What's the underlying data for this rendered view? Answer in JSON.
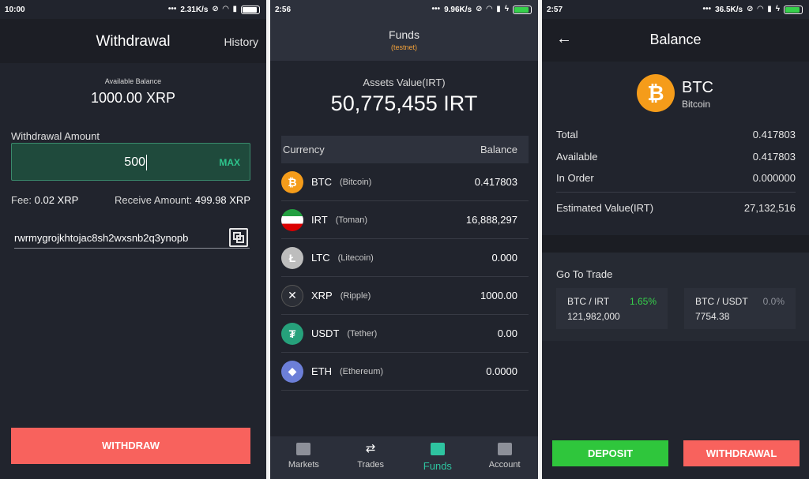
{
  "screen1": {
    "status": {
      "time": "10:00",
      "speed": "2.31K/s"
    },
    "header": {
      "title": "Withdrawal",
      "history": "History"
    },
    "available_caption": "Available Balance",
    "available_value": "1000.00 XRP",
    "amount_label": "Withdrawal Amount",
    "amount_value": "500",
    "max_label": "MAX",
    "fee_label": "Fee:",
    "fee_value": "0.02 XRP",
    "receive_label": "Receive Amount:",
    "receive_value": "499.98 XRP",
    "address": "rwrmygrojkhtojac8sh2wxsnb2q3ynopb",
    "withdraw_button": "WITHDRAW"
  },
  "screen2": {
    "status": {
      "time": "2:56",
      "speed": "9.96K/s"
    },
    "header": {
      "title": "Funds",
      "subtitle": "(testnet)"
    },
    "assets_caption": "Assets Value(IRT)",
    "assets_value": "50,775,455 IRT",
    "table_headers": {
      "currency": "Currency",
      "balance": "Balance"
    },
    "rows": [
      {
        "symbol": "BTC",
        "name": "(Bitcoin)",
        "balance": "0.417803",
        "icon": "bitcoin-icon",
        "color": "#f59c1a",
        "glyph": "₿"
      },
      {
        "symbol": "IRT",
        "name": "(Toman)",
        "balance": "16,888,297",
        "icon": "iran-flag-icon",
        "color": "#ffffff",
        "glyph": ""
      },
      {
        "symbol": "LTC",
        "name": "(Litecoin)",
        "balance": "0.000",
        "icon": "litecoin-icon",
        "color": "#bdbdbd",
        "glyph": "Ł"
      },
      {
        "symbol": "XRP",
        "name": "(Ripple)",
        "balance": "1000.00",
        "icon": "ripple-icon",
        "color": "#2b2e36",
        "glyph": "✕"
      },
      {
        "symbol": "USDT",
        "name": "(Tether)",
        "balance": "0.00",
        "icon": "tether-icon",
        "color": "#26a17b",
        "glyph": "₮"
      },
      {
        "symbol": "ETH",
        "name": "(Ethereum)",
        "balance": "0.0000",
        "icon": "ethereum-icon",
        "color": "#6c7fd8",
        "glyph": "◆"
      }
    ],
    "nav": [
      {
        "label": "Markets",
        "icon": "markets-icon",
        "active": false
      },
      {
        "label": "Trades",
        "icon": "trades-icon",
        "active": false
      },
      {
        "label": "Funds",
        "icon": "wallet-icon",
        "active": true
      },
      {
        "label": "Account",
        "icon": "account-icon",
        "active": false
      }
    ]
  },
  "screen3": {
    "status": {
      "time": "2:57",
      "speed": "36.5K/s"
    },
    "header": {
      "title": "Balance"
    },
    "coin_symbol": "BTC",
    "coin_name": "Bitcoin",
    "balances": [
      {
        "label": "Total",
        "value": "0.417803"
      },
      {
        "label": "Available",
        "value": "0.417803"
      },
      {
        "label": "In Order",
        "value": "0.000000"
      }
    ],
    "estimated_label": "Estimated Value(IRT)",
    "estimated_value": "27,132,516",
    "go_to_trade": "Go To Trade",
    "pairs": [
      {
        "name": "BTC / IRT",
        "change": "1.65%",
        "price": "121,982,000",
        "change_color": "#36d04b"
      },
      {
        "name": "BTC / USDT",
        "change": "0.0%",
        "price": "7754.38",
        "change_color": "#8d9099"
      }
    ],
    "deposit_button": "DEPOSIT",
    "withdrawal_button": "WITHDRAWAL",
    "colors": {
      "deposit": "#2fc63c",
      "withdrawal": "#f8625d"
    }
  }
}
